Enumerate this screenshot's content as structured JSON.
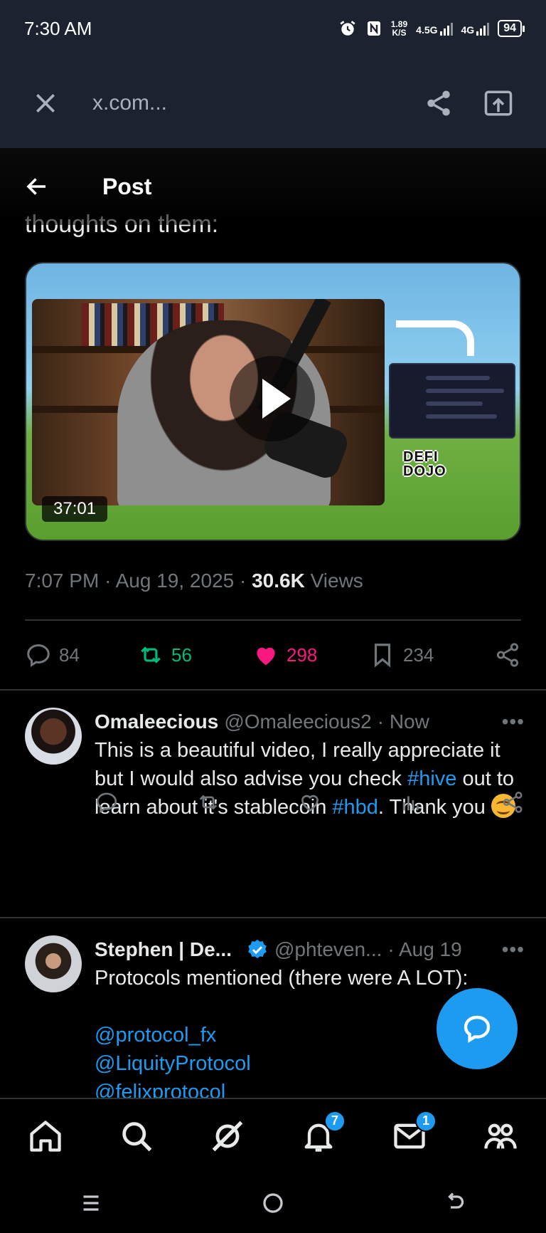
{
  "status_bar": {
    "time": "7:30 AM",
    "speed_value": "1.89",
    "speed_unit": "K/S",
    "net1": "4.5G",
    "net2": "4G",
    "battery": "94"
  },
  "browser": {
    "url": "x.com..."
  },
  "header": {
    "title": "Post",
    "partial_text": "thoughts on them:"
  },
  "video": {
    "duration": "37:01",
    "logo_line1": "DEFI",
    "logo_line2": "DOJO"
  },
  "post_meta": {
    "time": "7:07 PM",
    "date": "Aug 19, 2025",
    "views_count": "30.6K",
    "views_label": "Views",
    "separator": "·"
  },
  "stats": {
    "replies": "84",
    "reposts": "56",
    "likes": "298",
    "bookmarks": "234"
  },
  "replies": [
    {
      "name": "Omaleecious",
      "handle": "@Omaleecious2",
      "time": "· Now",
      "text_1": "This is a beautiful video, I really appreciate it but I would also advise you check ",
      "link_1": "#hive",
      "text_2": " out to learn about it's stablecoin ",
      "link_2": "#hbd",
      "text_3": ". Thank you "
    },
    {
      "name": "Stephen | De...",
      "handle": "@phteven...",
      "time": "· Aug 19",
      "text_1": "Protocols mentioned (there were A LOT):",
      "mention_1": "@protocol_fx",
      "mention_2": "@LiquityProtocol",
      "mention_3": "@felixprotocol"
    }
  ],
  "more_label": "•••",
  "nav": {
    "notifications_badge": "7",
    "messages_badge": "1"
  },
  "colors": {
    "accent": "#1d9bf0",
    "repost": "#00ba7c",
    "like": "#f91880",
    "muted": "#71767b"
  }
}
